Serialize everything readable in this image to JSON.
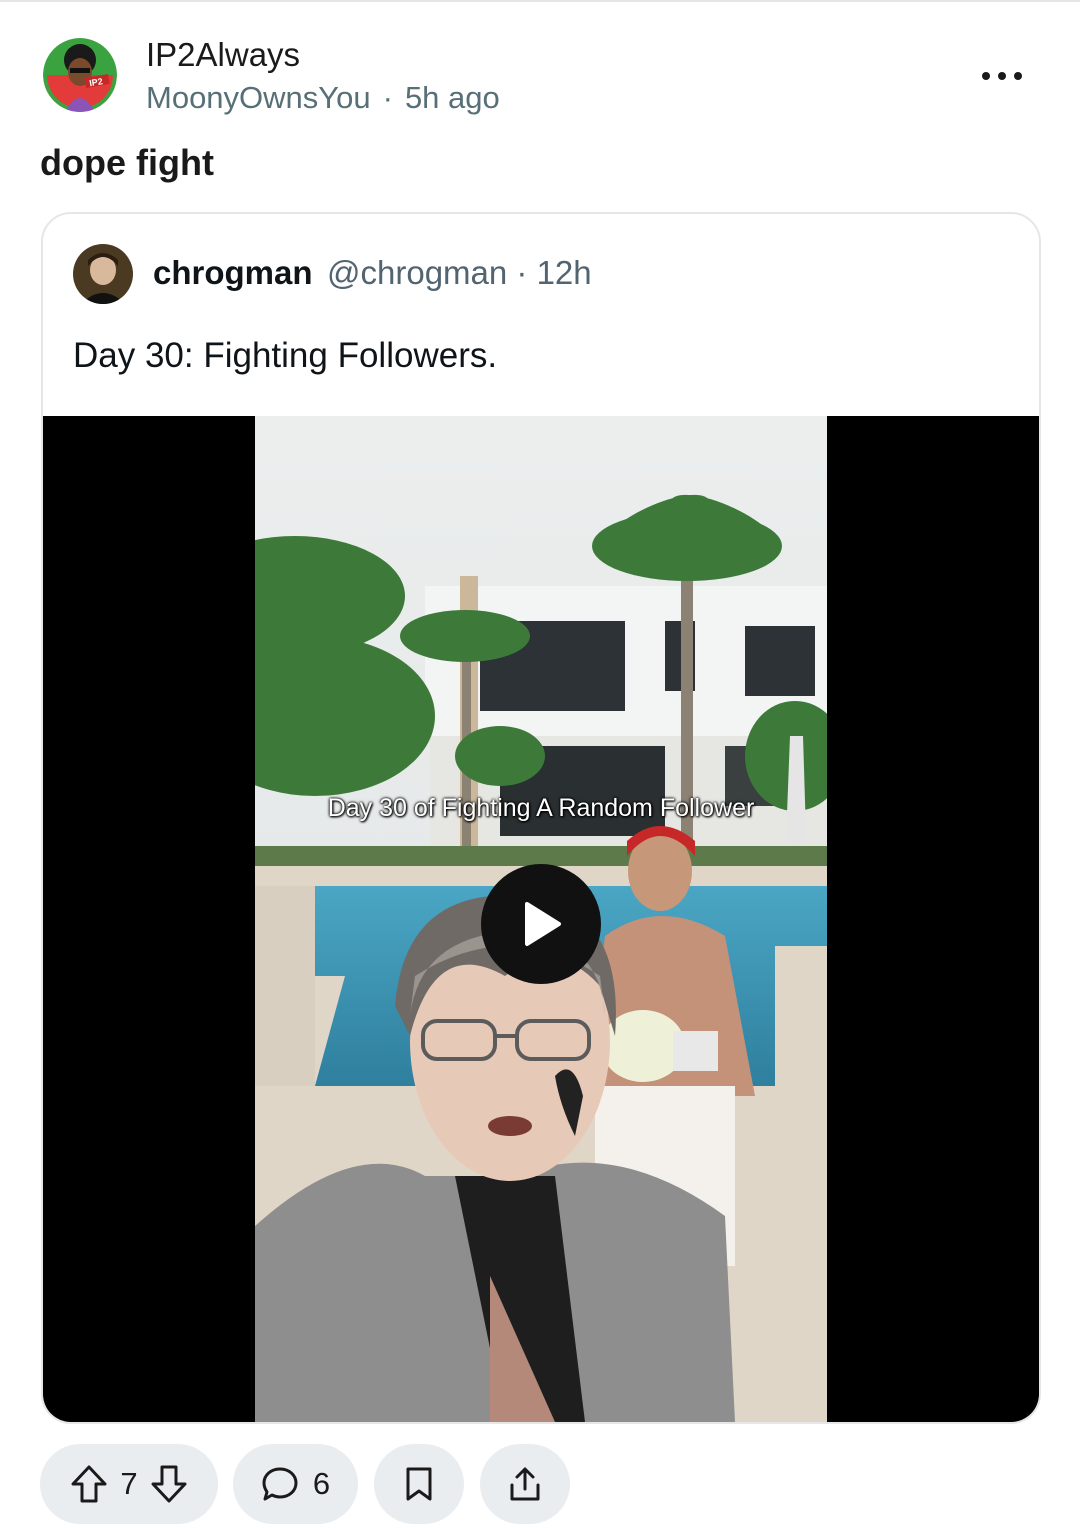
{
  "post": {
    "community": "IP2Always",
    "author": "MoonyOwnsYou",
    "separator": "·",
    "time": "5h ago",
    "title": "dope fight",
    "avatar_badge": "IP2"
  },
  "embed": {
    "display_name": "chrogman",
    "handle_time": "@chrogman · 12h",
    "text": "Day 30: Fighting Followers.",
    "video_caption": "Day 30 of Fighting A Random Follower"
  },
  "actions": {
    "upvotes": "7",
    "comments": "6"
  },
  "icons": {
    "more": "more-horizontal-icon",
    "upvote": "arrow-up-icon",
    "downvote": "arrow-down-icon",
    "comment": "speech-bubble-icon",
    "save": "bookmark-icon",
    "share": "share-icon",
    "play": "play-icon"
  },
  "colors": {
    "meta_text": "#576f76",
    "pill_bg": "#eaedef",
    "card_border": "#e4e6e8"
  }
}
